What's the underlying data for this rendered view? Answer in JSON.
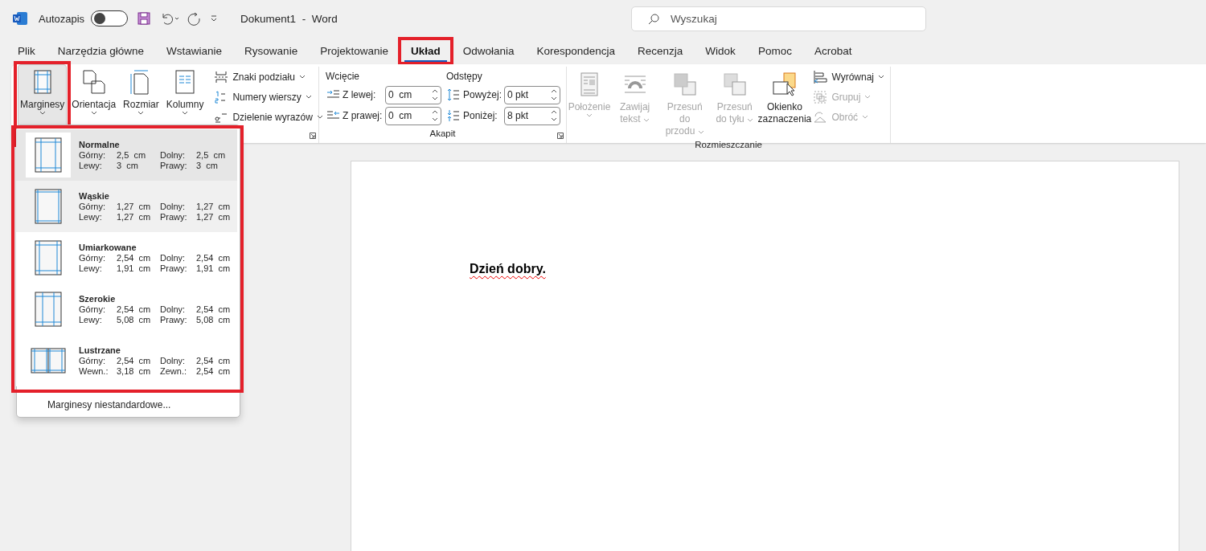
{
  "title_bar": {
    "autosave_label": "Autozapis",
    "autosave_on": false,
    "document_title": "Dokument1  -  Word",
    "search": {
      "placeholder": "Wyszukaj"
    }
  },
  "tabs": [
    {
      "label": "Plik",
      "selected": false,
      "highlighted": false
    },
    {
      "label": "Narzędzia główne",
      "selected": false,
      "highlighted": false
    },
    {
      "label": "Wstawianie",
      "selected": false,
      "highlighted": false
    },
    {
      "label": "Rysowanie",
      "selected": false,
      "highlighted": false
    },
    {
      "label": "Projektowanie",
      "selected": false,
      "highlighted": false
    },
    {
      "label": "Układ",
      "selected": true,
      "highlighted": true
    },
    {
      "label": "Odwołania",
      "selected": false,
      "highlighted": false
    },
    {
      "label": "Korespondencja",
      "selected": false,
      "highlighted": false
    },
    {
      "label": "Recenzja",
      "selected": false,
      "highlighted": false
    },
    {
      "label": "Widok",
      "selected": false,
      "highlighted": false
    },
    {
      "label": "Pomoc",
      "selected": false,
      "highlighted": false
    },
    {
      "label": "Acrobat",
      "selected": false,
      "highlighted": false
    }
  ],
  "ribbon": {
    "page_setup": {
      "large_buttons": [
        {
          "label": "Marginesy",
          "kind": "margins",
          "dropdown": true,
          "caret_inline": false,
          "selected": true,
          "highlighted": true
        },
        {
          "label": "Orientacja",
          "kind": "orientation",
          "dropdown": true,
          "caret_inline": false,
          "selected": false,
          "highlighted": false
        },
        {
          "label": "Rozmiar",
          "kind": "size",
          "dropdown": true,
          "caret_inline": false,
          "selected": false,
          "highlighted": false
        },
        {
          "label": "Kolumny",
          "kind": "columns",
          "dropdown": true,
          "caret_inline": false,
          "selected": false,
          "highlighted": false
        }
      ],
      "small_buttons": [
        {
          "label": "Znaki podziału",
          "kind": "breaks",
          "disabled": false
        },
        {
          "label": "Numery wierszy",
          "kind": "line-numbers",
          "disabled": false
        },
        {
          "label": "Dzielenie wyrazów",
          "kind": "hyphenation",
          "disabled": false
        }
      ]
    },
    "paragraph": {
      "title": "Akapit",
      "indent": {
        "title": "Wcięcie",
        "fields": [
          {
            "label": "Z lewej:",
            "value": "0  cm",
            "kind": "indent-left"
          },
          {
            "label": "Z prawej:",
            "value": "0  cm",
            "kind": "indent-right"
          }
        ]
      },
      "spacing": {
        "title": "Odstępy",
        "fields": [
          {
            "label": "Powyżej:",
            "value": "0 pkt",
            "kind": "space-before"
          },
          {
            "label": "Poniżej:",
            "value": "8 pkt",
            "kind": "space-after"
          }
        ]
      }
    },
    "arrange": {
      "title": "Rozmieszczanie",
      "large_buttons": [
        {
          "label": "Położenie",
          "kind": "position",
          "dropdown": true,
          "caret_inline": false,
          "disabled": true
        },
        {
          "label": "Zawijaj tekst",
          "kind": "wrap",
          "dropdown": true,
          "caret_inline": true,
          "disabled": true
        },
        {
          "label": "Przesuń do przodu",
          "kind": "forward",
          "dropdown": true,
          "caret_inline": true,
          "disabled": true
        },
        {
          "label": "Przesuń do tyłu",
          "kind": "backward",
          "dropdown": true,
          "caret_inline": true,
          "disabled": true
        },
        {
          "label": "Okienko zaznaczenia",
          "kind": "selection-pane",
          "dropdown": false,
          "disabled": false
        }
      ],
      "small_buttons": [
        {
          "label": "Wyrównaj",
          "kind": "align",
          "disabled": false
        },
        {
          "label": "Grupuj",
          "kind": "group",
          "disabled": true
        },
        {
          "label": "Obróć",
          "kind": "rotate",
          "disabled": true
        }
      ]
    }
  },
  "margins_menu": {
    "highlighted": true,
    "items": [
      {
        "name": "Normalne",
        "kind": "normal",
        "selected": true,
        "hovered": false,
        "values": [
          {
            "label": "Górny:",
            "value": "2,5  cm"
          },
          {
            "label": "Dolny:",
            "value": "2,5  cm"
          },
          {
            "label": "Lewy:",
            "value": "3  cm"
          },
          {
            "label": "Prawy:",
            "value": "3  cm"
          }
        ]
      },
      {
        "name": "Wąskie",
        "kind": "narrow",
        "selected": false,
        "hovered": true,
        "values": [
          {
            "label": "Górny:",
            "value": "1,27  cm"
          },
          {
            "label": "Dolny:",
            "value": "1,27  cm"
          },
          {
            "label": "Lewy:",
            "value": "1,27  cm"
          },
          {
            "label": "Prawy:",
            "value": "1,27  cm"
          }
        ]
      },
      {
        "name": "Umiarkowane",
        "kind": "moderate",
        "selected": false,
        "hovered": false,
        "values": [
          {
            "label": "Górny:",
            "value": "2,54  cm"
          },
          {
            "label": "Dolny:",
            "value": "2,54  cm"
          },
          {
            "label": "Lewy:",
            "value": "1,91  cm"
          },
          {
            "label": "Prawy:",
            "value": "1,91  cm"
          }
        ]
      },
      {
        "name": "Szerokie",
        "kind": "wide",
        "selected": false,
        "hovered": false,
        "values": [
          {
            "label": "Górny:",
            "value": "2,54  cm"
          },
          {
            "label": "Dolny:",
            "value": "2,54  cm"
          },
          {
            "label": "Lewy:",
            "value": "5,08  cm"
          },
          {
            "label": "Prawy:",
            "value": "5,08  cm"
          }
        ]
      },
      {
        "name": "Lustrzane",
        "kind": "mirrored",
        "selected": false,
        "hovered": false,
        "values": [
          {
            "label": "Górny:",
            "value": "2,54  cm"
          },
          {
            "label": "Dolny:",
            "value": "2,54  cm"
          },
          {
            "label": "Wewn.:",
            "value": "3,18  cm"
          },
          {
            "label": "Zewn.:",
            "value": "2,54  cm"
          }
        ]
      }
    ],
    "footer": "Marginesy niestandardowe..."
  },
  "document": {
    "text": "Dzień dobry.",
    "misspelled": true
  }
}
